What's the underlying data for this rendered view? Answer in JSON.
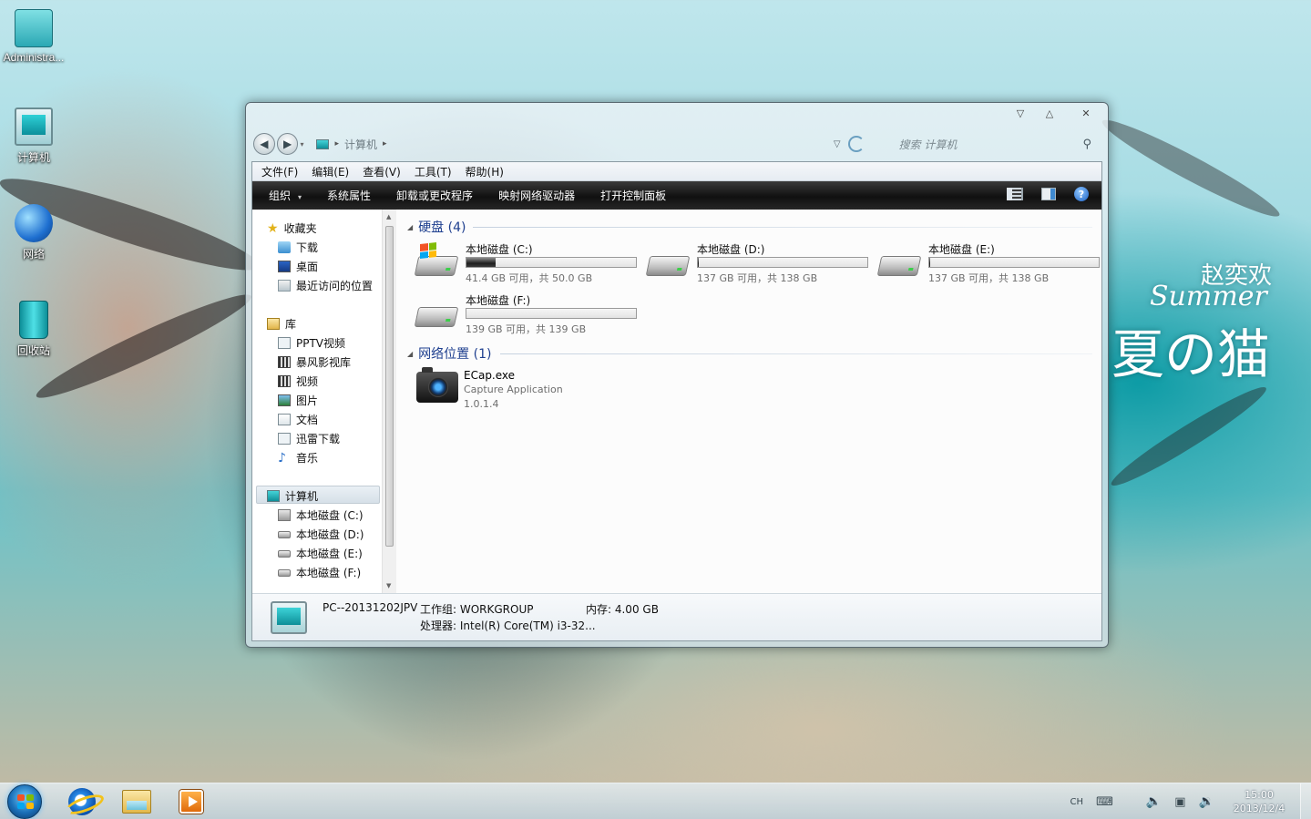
{
  "desktop": {
    "icons": [
      {
        "label": "Administra...",
        "icon": "folder-icon"
      },
      {
        "label": "计算机",
        "icon": "computer-icon"
      },
      {
        "label": "网络",
        "icon": "network-globe-icon"
      },
      {
        "label": "回收站",
        "icon": "recycle-bin-icon"
      }
    ],
    "wallpaper_text": {
      "name": "赵奕欢",
      "script": "Summer",
      "title": "夏の猫"
    }
  },
  "window": {
    "controls": [
      "minimize",
      "maximize",
      "close"
    ],
    "address": {
      "location": "计算机",
      "search_placeholder": "搜索 计算机"
    },
    "menu": [
      "文件(F)",
      "编辑(E)",
      "查看(V)",
      "工具(T)",
      "帮助(H)"
    ],
    "toolbar": {
      "items": [
        "组织",
        "系统属性",
        "卸载或更改程序",
        "映射网络驱动器",
        "打开控制面板"
      ],
      "help": "?"
    },
    "nav": {
      "favorites": {
        "label": "收藏夹",
        "items": [
          "下载",
          "桌面",
          "最近访问的位置"
        ]
      },
      "libraries": {
        "label": "库",
        "items": [
          "PPTV视频",
          "暴风影视库",
          "视频",
          "图片",
          "文档",
          "迅雷下载",
          "音乐"
        ]
      },
      "computer": {
        "label": "计算机",
        "items": [
          "本地磁盘 (C:)",
          "本地磁盘 (D:)",
          "本地磁盘 (E:)",
          "本地磁盘 (F:)"
        ]
      }
    },
    "content": {
      "drives_header": "硬盘 (4)",
      "drives": [
        {
          "name": "本地磁盘 (C:)",
          "info": "41.4 GB 可用，共 50.0 GB",
          "used_fraction": 0.172
        },
        {
          "name": "本地磁盘 (D:)",
          "info": "137 GB 可用，共 138 GB",
          "used_fraction": 0.007
        },
        {
          "name": "本地磁盘 (E:)",
          "info": "137 GB 可用，共 138 GB",
          "used_fraction": 0.007
        },
        {
          "name": "本地磁盘 (F:)",
          "info": "139 GB 可用，共 139 GB",
          "used_fraction": 0.0
        }
      ],
      "network_header": "网络位置 (1)",
      "network_item": {
        "name": "ECap.exe",
        "desc": "Capture Application",
        "version": "1.0.1.4"
      }
    },
    "details": {
      "pc_name": "PC--20131202JPV",
      "workgroup": "工作组: WORKGROUP",
      "memory": "内存: 4.00 GB",
      "processor": "处理器: Intel(R) Core(TM) i3-32..."
    }
  },
  "taskbar": {
    "apps": [
      "internet-explorer-icon",
      "windows-explorer-icon",
      "media-player-icon"
    ],
    "tray": {
      "lang": "CH",
      "time": "15:00",
      "date": "2013/12/4"
    }
  },
  "colors": {
    "group_header": "#1e3f8f",
    "toolbar_bg": "#101010",
    "taskbar": "#c8dce6"
  }
}
